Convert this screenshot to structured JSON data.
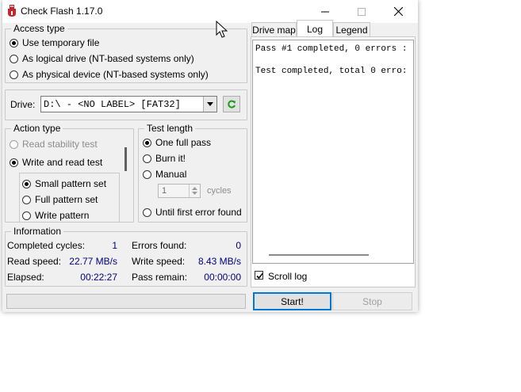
{
  "window": {
    "title": "Check Flash 1.17.0"
  },
  "access_type": {
    "title": "Access type",
    "options": [
      {
        "label": "Use temporary file",
        "selected": true
      },
      {
        "label": "As logical drive (NT-based systems only)",
        "selected": false
      },
      {
        "label": "As physical device (NT-based systems only)",
        "selected": false
      }
    ]
  },
  "drive": {
    "label": "Drive:",
    "value": "D:\\ - <NO LABEL> [FAT32]"
  },
  "action_type": {
    "title": "Action type",
    "options": [
      {
        "label": "Read stability test",
        "selected": false,
        "disabled": true
      },
      {
        "label": "Write and read test",
        "selected": true,
        "disabled": false
      }
    ],
    "sub_options": [
      {
        "label": "Small pattern set",
        "selected": true
      },
      {
        "label": "Full pattern set",
        "selected": false
      },
      {
        "label": "Write pattern",
        "selected": false
      }
    ]
  },
  "test_length": {
    "title": "Test length",
    "options": [
      {
        "label": "One full pass",
        "selected": true
      },
      {
        "label": "Burn it!",
        "selected": false
      },
      {
        "label": "Manual",
        "selected": false
      }
    ],
    "cycles_value": "1",
    "cycles_label": "cycles",
    "until_error": "Until first error found"
  },
  "information": {
    "title": "Information",
    "completed_cycles_label": "Completed cycles:",
    "completed_cycles": "1",
    "errors_found_label": "Errors found:",
    "errors_found": "0",
    "read_speed_label": "Read speed:",
    "read_speed": "22.77 MB/s",
    "write_speed_label": "Write speed:",
    "write_speed": "8.43 MB/s",
    "elapsed_label": "Elapsed:",
    "elapsed": "00:22:27",
    "pass_remain_label": "Pass remain:",
    "pass_remain": "00:00:00"
  },
  "tabs": [
    "Drive map",
    "Log",
    "Legend"
  ],
  "log": {
    "lines": [
      "Pass #1 completed, 0 errors :",
      "Test completed, total 0 erro:"
    ]
  },
  "scroll_log": {
    "label": "Scroll log",
    "checked": true
  },
  "buttons": {
    "start": "Start!",
    "stop": "Stop"
  },
  "colors": {
    "value_text": "#00007f",
    "refresh_green": "#1a9b1a",
    "icon_red": "#c0282d"
  }
}
